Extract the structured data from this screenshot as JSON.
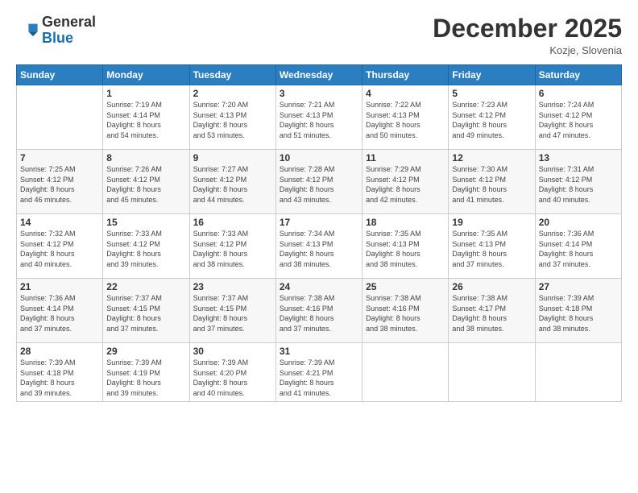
{
  "header": {
    "logo_general": "General",
    "logo_blue": "Blue",
    "month_year": "December 2025",
    "location": "Kozje, Slovenia"
  },
  "weekdays": [
    "Sunday",
    "Monday",
    "Tuesday",
    "Wednesday",
    "Thursday",
    "Friday",
    "Saturday"
  ],
  "weeks": [
    [
      {
        "day": "",
        "info": ""
      },
      {
        "day": "1",
        "info": "Sunrise: 7:19 AM\nSunset: 4:14 PM\nDaylight: 8 hours\nand 54 minutes."
      },
      {
        "day": "2",
        "info": "Sunrise: 7:20 AM\nSunset: 4:13 PM\nDaylight: 8 hours\nand 53 minutes."
      },
      {
        "day": "3",
        "info": "Sunrise: 7:21 AM\nSunset: 4:13 PM\nDaylight: 8 hours\nand 51 minutes."
      },
      {
        "day": "4",
        "info": "Sunrise: 7:22 AM\nSunset: 4:13 PM\nDaylight: 8 hours\nand 50 minutes."
      },
      {
        "day": "5",
        "info": "Sunrise: 7:23 AM\nSunset: 4:12 PM\nDaylight: 8 hours\nand 49 minutes."
      },
      {
        "day": "6",
        "info": "Sunrise: 7:24 AM\nSunset: 4:12 PM\nDaylight: 8 hours\nand 47 minutes."
      }
    ],
    [
      {
        "day": "7",
        "info": "Sunrise: 7:25 AM\nSunset: 4:12 PM\nDaylight: 8 hours\nand 46 minutes."
      },
      {
        "day": "8",
        "info": "Sunrise: 7:26 AM\nSunset: 4:12 PM\nDaylight: 8 hours\nand 45 minutes."
      },
      {
        "day": "9",
        "info": "Sunrise: 7:27 AM\nSunset: 4:12 PM\nDaylight: 8 hours\nand 44 minutes."
      },
      {
        "day": "10",
        "info": "Sunrise: 7:28 AM\nSunset: 4:12 PM\nDaylight: 8 hours\nand 43 minutes."
      },
      {
        "day": "11",
        "info": "Sunrise: 7:29 AM\nSunset: 4:12 PM\nDaylight: 8 hours\nand 42 minutes."
      },
      {
        "day": "12",
        "info": "Sunrise: 7:30 AM\nSunset: 4:12 PM\nDaylight: 8 hours\nand 41 minutes."
      },
      {
        "day": "13",
        "info": "Sunrise: 7:31 AM\nSunset: 4:12 PM\nDaylight: 8 hours\nand 40 minutes."
      }
    ],
    [
      {
        "day": "14",
        "info": "Sunrise: 7:32 AM\nSunset: 4:12 PM\nDaylight: 8 hours\nand 40 minutes."
      },
      {
        "day": "15",
        "info": "Sunrise: 7:33 AM\nSunset: 4:12 PM\nDaylight: 8 hours\nand 39 minutes."
      },
      {
        "day": "16",
        "info": "Sunrise: 7:33 AM\nSunset: 4:12 PM\nDaylight: 8 hours\nand 38 minutes."
      },
      {
        "day": "17",
        "info": "Sunrise: 7:34 AM\nSunset: 4:13 PM\nDaylight: 8 hours\nand 38 minutes."
      },
      {
        "day": "18",
        "info": "Sunrise: 7:35 AM\nSunset: 4:13 PM\nDaylight: 8 hours\nand 38 minutes."
      },
      {
        "day": "19",
        "info": "Sunrise: 7:35 AM\nSunset: 4:13 PM\nDaylight: 8 hours\nand 37 minutes."
      },
      {
        "day": "20",
        "info": "Sunrise: 7:36 AM\nSunset: 4:14 PM\nDaylight: 8 hours\nand 37 minutes."
      }
    ],
    [
      {
        "day": "21",
        "info": "Sunrise: 7:36 AM\nSunset: 4:14 PM\nDaylight: 8 hours\nand 37 minutes."
      },
      {
        "day": "22",
        "info": "Sunrise: 7:37 AM\nSunset: 4:15 PM\nDaylight: 8 hours\nand 37 minutes."
      },
      {
        "day": "23",
        "info": "Sunrise: 7:37 AM\nSunset: 4:15 PM\nDaylight: 8 hours\nand 37 minutes."
      },
      {
        "day": "24",
        "info": "Sunrise: 7:38 AM\nSunset: 4:16 PM\nDaylight: 8 hours\nand 37 minutes."
      },
      {
        "day": "25",
        "info": "Sunrise: 7:38 AM\nSunset: 4:16 PM\nDaylight: 8 hours\nand 38 minutes."
      },
      {
        "day": "26",
        "info": "Sunrise: 7:38 AM\nSunset: 4:17 PM\nDaylight: 8 hours\nand 38 minutes."
      },
      {
        "day": "27",
        "info": "Sunrise: 7:39 AM\nSunset: 4:18 PM\nDaylight: 8 hours\nand 38 minutes."
      }
    ],
    [
      {
        "day": "28",
        "info": "Sunrise: 7:39 AM\nSunset: 4:18 PM\nDaylight: 8 hours\nand 39 minutes."
      },
      {
        "day": "29",
        "info": "Sunrise: 7:39 AM\nSunset: 4:19 PM\nDaylight: 8 hours\nand 39 minutes."
      },
      {
        "day": "30",
        "info": "Sunrise: 7:39 AM\nSunset: 4:20 PM\nDaylight: 8 hours\nand 40 minutes."
      },
      {
        "day": "31",
        "info": "Sunrise: 7:39 AM\nSunset: 4:21 PM\nDaylight: 8 hours\nand 41 minutes."
      },
      {
        "day": "",
        "info": ""
      },
      {
        "day": "",
        "info": ""
      },
      {
        "day": "",
        "info": ""
      }
    ]
  ]
}
